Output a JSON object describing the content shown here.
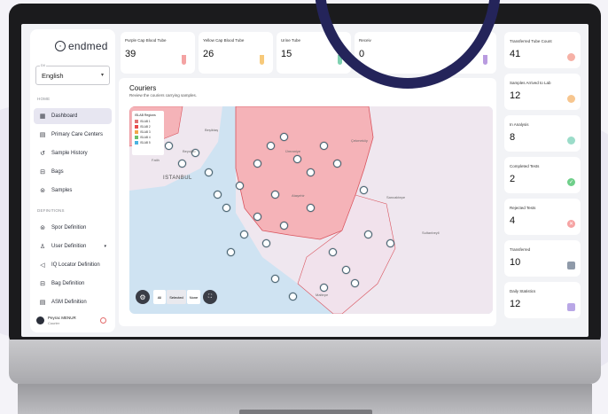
{
  "brand": {
    "logo_text": "endmed"
  },
  "language": {
    "label": "Dil",
    "value": "English"
  },
  "sidebar": {
    "section_home": "HOME",
    "section_definitions": "DEFINITIONS",
    "items": [
      {
        "label": "Dashboard",
        "icon": "dashboard-icon",
        "active": true
      },
      {
        "label": "Primary Care Centers",
        "icon": "building-icon"
      },
      {
        "label": "Sample History",
        "icon": "history-icon"
      },
      {
        "label": "Bags",
        "icon": "bag-icon"
      },
      {
        "label": "Samples",
        "icon": "sample-icon"
      }
    ],
    "def_items": [
      {
        "label": "Spor Definition",
        "icon": "sample-icon"
      },
      {
        "label": "User Definition",
        "icon": "user-icon"
      },
      {
        "label": "IQ Locator Definition",
        "icon": "locator-icon"
      },
      {
        "label": "Bag Definition",
        "icon": "bag-icon"
      },
      {
        "label": "ASM Definition",
        "icon": "building-icon"
      }
    ],
    "user": {
      "name": "Peyrac MENUR",
      "role": "Courier"
    }
  },
  "top_cards": [
    {
      "label": "Purple Cap Blood Tube",
      "value": "39",
      "color": "#f4a3a3"
    },
    {
      "label": "Yellow Cap Blood Tube",
      "value": "26",
      "color": "#f7c97a"
    },
    {
      "label": "Urine Tube",
      "value": "15",
      "color": "#7fd1b1"
    },
    {
      "label": "Receiv",
      "value": "0",
      "color": "#b99be0"
    }
  ],
  "map_card": {
    "title": "Couriers",
    "subtitle": "Review the couriers carrying samples.",
    "legend_title": "ISLAB Regions",
    "legend": [
      {
        "label": "ISLAB 1",
        "color": "#e07070"
      },
      {
        "label": "ISLAB 2",
        "color": "#e84a4a"
      },
      {
        "label": "ISLAB 3",
        "color": "#f2a64a"
      },
      {
        "label": "ISLAB 4",
        "color": "#6bbf6b"
      },
      {
        "label": "ISLAB 5",
        "color": "#4ab3e0"
      }
    ],
    "controls": {
      "all": "All",
      "selected": "Selected",
      "none": "None"
    },
    "places": {
      "istanbul": "ISTANBUL",
      "atasehir": "Ataşehir",
      "umraniye": "Ümraniye",
      "cekmekoy": "Çekmeköy",
      "maltepe": "Maltepe",
      "sancaktepe": "Sancaktepe",
      "sultanbeyli": "Sultanbeyli",
      "besiktas": "Beşiktaş",
      "beyoglu": "Beyoğlu",
      "fatih": "Fatih"
    }
  },
  "right_cards": [
    {
      "label": "Transferred Tube Count",
      "value": "41",
      "icon": "truck-icon",
      "color": "#f6b1a6"
    },
    {
      "label": "Samples Arrived to Lab",
      "value": "12",
      "icon": "clock-icon",
      "color": "#f7c68f"
    },
    {
      "label": "In Analysis",
      "value": "8",
      "icon": "progress-icon",
      "color": "#9bdcc9"
    },
    {
      "label": "Completed Tests",
      "value": "2",
      "icon": "check-icon",
      "color": "#6fcf8a"
    },
    {
      "label": "Rejected Tests",
      "value": "4",
      "icon": "x-icon",
      "color": "#f6a3a3"
    },
    {
      "label": "Transferred",
      "value": "10",
      "icon": "truck-icon",
      "color": "#8f9aa9"
    },
    {
      "label": "Daily Statistics",
      "value": "12",
      "icon": "calendar-icon",
      "color": "#b9a7e6"
    }
  ]
}
